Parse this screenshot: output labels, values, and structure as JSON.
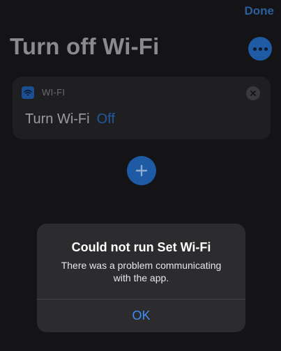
{
  "nav": {
    "done_label": "Done"
  },
  "shortcut": {
    "title": "Turn off Wi-Fi"
  },
  "action": {
    "app_label": "WI-FI",
    "text": "Turn Wi-Fi",
    "parameter": "Off"
  },
  "alert": {
    "title": "Could not run Set Wi-Fi",
    "message": "There was a problem communicating with the app.",
    "ok_label": "OK"
  },
  "icons": {
    "more": "ellipsis-icon",
    "app": "wifi-icon",
    "clear": "close-icon",
    "add": "plus-icon"
  },
  "colors": {
    "accent": "#3d8ff5",
    "dim_accent": "#1f5aa5",
    "alert_bg": "#2c2c2e"
  }
}
